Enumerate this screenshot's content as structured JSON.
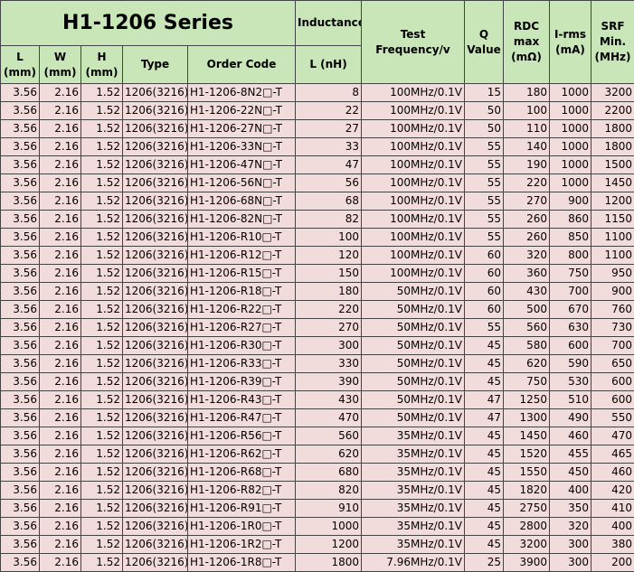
{
  "header": {
    "series_title": "H1-1206 Series",
    "inductance_group": "Inductance",
    "test_frequency": "Test Frequency/v",
    "q_value": "Q Value",
    "rdc_max": "RDC max (mΩ)",
    "irms": "I-rms (mA)",
    "srf_min": "SRF Min. (MHz)",
    "l_mm": "L (mm)",
    "w_mm": "W (mm)",
    "h_mm": "H (mm)",
    "type": "Type",
    "order_code": "Order Code",
    "l_nh": "L (nH)"
  },
  "rows": [
    [
      "3.56",
      "2.16",
      "1.52",
      "1206(3216)",
      "H1-1206-8N2□-T",
      "8",
      "100MHz/0.1V",
      "15",
      "180",
      "1000",
      "3200"
    ],
    [
      "3.56",
      "2.16",
      "1.52",
      "1206(3216)",
      "H1-1206-22N□-T",
      "22",
      "100MHz/0.1V",
      "50",
      "100",
      "1000",
      "2200"
    ],
    [
      "3.56",
      "2.16",
      "1.52",
      "1206(3216)",
      "H1-1206-27N□-T",
      "27",
      "100MHz/0.1V",
      "50",
      "110",
      "1000",
      "1800"
    ],
    [
      "3.56",
      "2.16",
      "1.52",
      "1206(3216)",
      "H1-1206-33N□-T",
      "33",
      "100MHz/0.1V",
      "55",
      "140",
      "1000",
      "1800"
    ],
    [
      "3.56",
      "2.16",
      "1.52",
      "1206(3216)",
      "H1-1206-47N□-T",
      "47",
      "100MHz/0.1V",
      "55",
      "190",
      "1000",
      "1500"
    ],
    [
      "3.56",
      "2.16",
      "1.52",
      "1206(3216)",
      "H1-1206-56N□-T",
      "56",
      "100MHz/0.1V",
      "55",
      "220",
      "1000",
      "1450"
    ],
    [
      "3.56",
      "2.16",
      "1.52",
      "1206(3216)",
      "H1-1206-68N□-T",
      "68",
      "100MHz/0.1V",
      "55",
      "270",
      "900",
      "1200"
    ],
    [
      "3.56",
      "2.16",
      "1.52",
      "1206(3216)",
      "H1-1206-82N□-T",
      "82",
      "100MHz/0.1V",
      "55",
      "260",
      "860",
      "1150"
    ],
    [
      "3.56",
      "2.16",
      "1.52",
      "1206(3216)",
      "H1-1206-R10□-T",
      "100",
      "100MHz/0.1V",
      "55",
      "260",
      "850",
      "1100"
    ],
    [
      "3.56",
      "2.16",
      "1.52",
      "1206(3216)",
      "H1-1206-R12□-T",
      "120",
      "100MHz/0.1V",
      "60",
      "320",
      "800",
      "1100"
    ],
    [
      "3.56",
      "2.16",
      "1.52",
      "1206(3216)",
      "H1-1206-R15□-T",
      "150",
      "100MHz/0.1V",
      "60",
      "360",
      "750",
      "950"
    ],
    [
      "3.56",
      "2.16",
      "1.52",
      "1206(3216)",
      "H1-1206-R18□-T",
      "180",
      "50MHz/0.1V",
      "60",
      "430",
      "700",
      "900"
    ],
    [
      "3.56",
      "2.16",
      "1.52",
      "1206(3216)",
      "H1-1206-R22□-T",
      "220",
      "50MHz/0.1V",
      "60",
      "500",
      "670",
      "760"
    ],
    [
      "3.56",
      "2.16",
      "1.52",
      "1206(3216)",
      "H1-1206-R27□-T",
      "270",
      "50MHz/0.1V",
      "55",
      "560",
      "630",
      "730"
    ],
    [
      "3.56",
      "2.16",
      "1.52",
      "1206(3216)",
      "H1-1206-R30□-T",
      "300",
      "50MHz/0.1V",
      "45",
      "580",
      "600",
      "700"
    ],
    [
      "3.56",
      "2.16",
      "1.52",
      "1206(3216)",
      "H1-1206-R33□-T",
      "330",
      "50MHz/0.1V",
      "45",
      "620",
      "590",
      "650"
    ],
    [
      "3.56",
      "2.16",
      "1.52",
      "1206(3216)",
      "H1-1206-R39□-T",
      "390",
      "50MHz/0.1V",
      "45",
      "750",
      "530",
      "600"
    ],
    [
      "3.56",
      "2.16",
      "1.52",
      "1206(3216)",
      "H1-1206-R43□-T",
      "430",
      "50MHz/0.1V",
      "47",
      "1250",
      "510",
      "600"
    ],
    [
      "3.56",
      "2.16",
      "1.52",
      "1206(3216)",
      "H1-1206-R47□-T",
      "470",
      "50MHz/0.1V",
      "47",
      "1300",
      "490",
      "550"
    ],
    [
      "3.56",
      "2.16",
      "1.52",
      "1206(3216)",
      "H1-1206-R56□-T",
      "560",
      "35MHz/0.1V",
      "45",
      "1450",
      "460",
      "470"
    ],
    [
      "3.56",
      "2.16",
      "1.52",
      "1206(3216)",
      "H1-1206-R62□-T",
      "620",
      "35MHz/0.1V",
      "45",
      "1520",
      "455",
      "465"
    ],
    [
      "3.56",
      "2.16",
      "1.52",
      "1206(3216)",
      "H1-1206-R68□-T",
      "680",
      "35MHz/0.1V",
      "45",
      "1550",
      "450",
      "460"
    ],
    [
      "3.56",
      "2.16",
      "1.52",
      "1206(3216)",
      "H1-1206-R82□-T",
      "820",
      "35MHz/0.1V",
      "45",
      "1820",
      "400",
      "420"
    ],
    [
      "3.56",
      "2.16",
      "1.52",
      "1206(3216)",
      "H1-1206-R91□-T",
      "910",
      "35MHz/0.1V",
      "45",
      "2750",
      "350",
      "410"
    ],
    [
      "3.56",
      "2.16",
      "1.52",
      "1206(3216)",
      "H1-1206-1R0□-T",
      "1000",
      "35MHz/0.1V",
      "45",
      "2800",
      "320",
      "400"
    ],
    [
      "3.56",
      "2.16",
      "1.52",
      "1206(3216)",
      "H1-1206-1R2□-T",
      "1200",
      "35MHz/0.1V",
      "45",
      "3200",
      "300",
      "380"
    ],
    [
      "3.56",
      "2.16",
      "1.52",
      "1206(3216)",
      "H1-1206-1R8□-T",
      "1800",
      "7.96MHz/0.1V",
      "25",
      "3900",
      "300",
      "200"
    ]
  ]
}
